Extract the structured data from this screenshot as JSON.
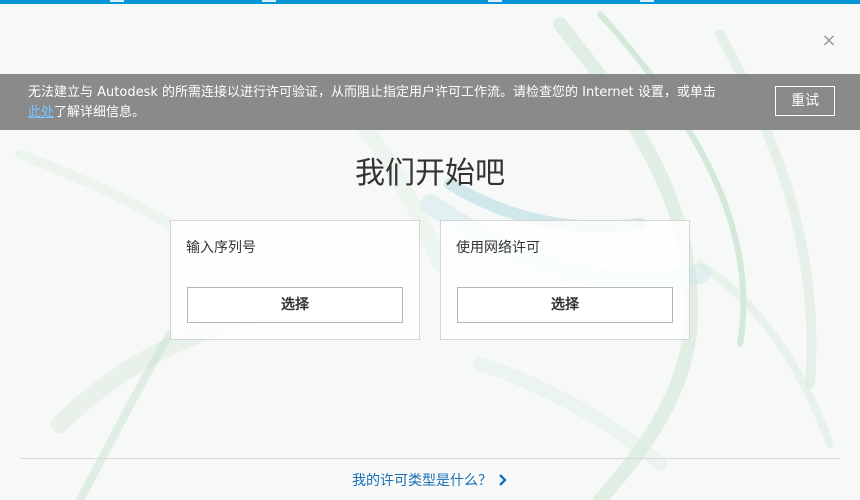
{
  "window": {
    "close_glyph": "×"
  },
  "warning": {
    "text_before": "无法建立与 Autodesk 的所需连接以进行许可验证，从而阻止指定用户许可工作流。请检查您的 Internet 设置，或单击",
    "link_text": "此处",
    "text_after": "了解详细信息。",
    "retry_label": "重试"
  },
  "main": {
    "title": "我们开始吧",
    "options": [
      {
        "label": "输入序列号",
        "button_label": "选择"
      },
      {
        "label": "使用网络许可",
        "button_label": "选择"
      }
    ]
  },
  "footer": {
    "link_text": "我的许可类型是什么？"
  },
  "colors": {
    "accent_blue": "#0696d7",
    "link_blue": "#1a6fb3",
    "warning_bg": "#808080"
  },
  "icons": {
    "close": "close-icon",
    "chevron": "chevron-right-icon"
  }
}
